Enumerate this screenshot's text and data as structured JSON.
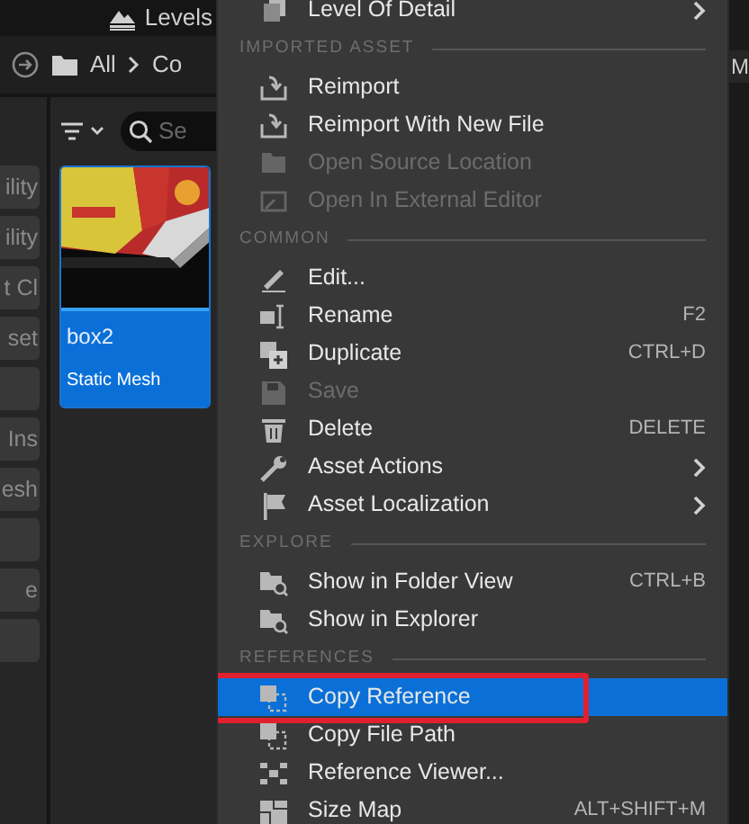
{
  "top_bar": {
    "tab": "Levels"
  },
  "breadcrumb": [
    "All",
    "Co"
  ],
  "right_edge_text": "M",
  "filter": {
    "search_placeholder": "Se"
  },
  "side_buttons": [
    {
      "kind": "text",
      "label": "ility"
    },
    {
      "kind": "text",
      "label": "ility"
    },
    {
      "kind": "text",
      "label": "t Cl"
    },
    {
      "kind": "text",
      "label": "set"
    },
    {
      "kind": "blank"
    },
    {
      "kind": "text",
      "label": "Ins"
    },
    {
      "kind": "text",
      "label": "esh"
    },
    {
      "kind": "blank"
    },
    {
      "kind": "text",
      "label": "e"
    },
    {
      "kind": "blank"
    }
  ],
  "asset": {
    "name": "box2",
    "type": "Static Mesh",
    "selected": true
  },
  "menu": [
    {
      "kind": "item",
      "label": "Level Of Detail",
      "submenu": true,
      "disabled": false,
      "selected": false
    },
    {
      "kind": "section",
      "label": "IMPORTED ASSET"
    },
    {
      "kind": "item",
      "label": "Reimport",
      "disabled": false,
      "selected": false
    },
    {
      "kind": "item",
      "label": "Reimport With New File",
      "disabled": false,
      "selected": false
    },
    {
      "kind": "item",
      "label": "Open Source Location",
      "disabled": true,
      "selected": false
    },
    {
      "kind": "item",
      "label": "Open In External Editor",
      "disabled": true,
      "selected": false
    },
    {
      "kind": "section",
      "label": "COMMON"
    },
    {
      "kind": "item",
      "label": "Edit...",
      "disabled": false,
      "selected": false
    },
    {
      "kind": "item",
      "label": "Rename",
      "shortcut": "F2",
      "disabled": false,
      "selected": false
    },
    {
      "kind": "item",
      "label": "Duplicate",
      "shortcut": "CTRL+D",
      "disabled": false,
      "selected": false
    },
    {
      "kind": "item",
      "label": "Save",
      "disabled": true,
      "selected": false
    },
    {
      "kind": "item",
      "label": "Delete",
      "shortcut": "DELETE",
      "disabled": false,
      "selected": false
    },
    {
      "kind": "item",
      "label": "Asset Actions",
      "submenu": true,
      "disabled": false,
      "selected": false
    },
    {
      "kind": "item",
      "label": "Asset Localization",
      "submenu": true,
      "disabled": false,
      "selected": false
    },
    {
      "kind": "section",
      "label": "EXPLORE"
    },
    {
      "kind": "item",
      "label": "Show in Folder View",
      "shortcut": "CTRL+B",
      "disabled": false,
      "selected": false
    },
    {
      "kind": "item",
      "label": "Show in Explorer",
      "disabled": false,
      "selected": false
    },
    {
      "kind": "section",
      "label": "REFERENCES"
    },
    {
      "kind": "item",
      "label": "Copy Reference",
      "disabled": false,
      "selected": true,
      "outlined": true
    },
    {
      "kind": "item",
      "label": "Copy File Path",
      "disabled": false,
      "selected": false
    },
    {
      "kind": "item",
      "label": "Reference Viewer...",
      "disabled": false,
      "selected": false
    },
    {
      "kind": "item",
      "label": "Size Map",
      "shortcut": "ALT+SHIFT+M",
      "disabled": false,
      "selected": false
    }
  ]
}
